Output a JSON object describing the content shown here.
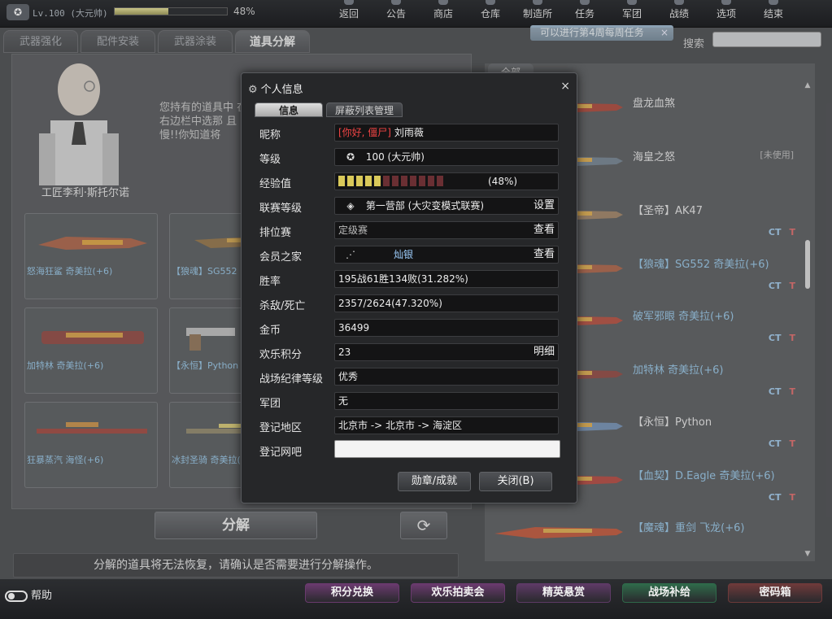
{
  "top": {
    "level_text": "Lv.100 (大元帅)",
    "exp_percent_label": "48%",
    "exp_fraction": 0.48,
    "nav": [
      "返回",
      "公告",
      "商店",
      "仓库",
      "制造所",
      "任务",
      "军团",
      "战绩",
      "选项",
      "结束"
    ]
  },
  "tabs": [
    "武器强化",
    "配件安装",
    "武器涂装",
    "道具分解"
  ],
  "notice": {
    "text": "可以进行第4周每周任务",
    "close": "×"
  },
  "search": {
    "label": "搜索",
    "placeholder": ""
  },
  "npc": {
    "name": "工匠李利·斯托尔诺",
    "speech": "您持有的道具中 在右边栏中选那 且慢!!你知道将"
  },
  "left_weapons": [
    {
      "name": "怒海狂鲨 奇美拉(+6)"
    },
    {
      "name": "【狼魂】SG552"
    },
    {
      "name": "加特林 奇美拉(+6)"
    },
    {
      "name": "【永恒】Python"
    },
    {
      "name": "狂暴蒸汽 海怪(+6)"
    },
    {
      "name": "冰封圣骑 奇美拉(+6)"
    }
  ],
  "actions": {
    "decompose": "分解",
    "refresh_icon": "refresh-icon"
  },
  "warning": "分解的道具将无法恢复，请确认是否需要进行分解操作。",
  "right": {
    "tab_all": "全部",
    "items": [
      {
        "name": "盘龙血煞",
        "tag": "",
        "ct": false,
        "color": "#e8e8e8"
      },
      {
        "name": "海皇之怒",
        "tag": "[未使用]",
        "ct": false,
        "color": "#e8e8e8"
      },
      {
        "name": "【圣帝】AK47",
        "tag": "",
        "ct": true,
        "color": "#e8e8e8"
      },
      {
        "name": "【狼魂】SG552 奇美拉(+6)",
        "tag": "",
        "ct": true,
        "color": "#8fc4e8"
      },
      {
        "name": "破军邪眼 奇美拉(+6)",
        "tag": "",
        "ct": true,
        "color": "#8fc4e8"
      },
      {
        "name": "加特林 奇美拉(+6)",
        "tag": "",
        "ct": true,
        "color": "#8fc4e8"
      },
      {
        "name": "【永恒】Python",
        "tag": "",
        "ct": true,
        "color": "#e8e8e8"
      },
      {
        "name": "【血契】D.Eagle  奇美拉(+6)",
        "tag": "",
        "ct": true,
        "color": "#8fc4e8"
      },
      {
        "name": "【魔魂】重剑 飞龙(+6)",
        "tag": "",
        "ct": false,
        "color": "#8fc4e8"
      }
    ],
    "ct_label": "CT",
    "t_label": "T"
  },
  "bottom": {
    "help": "帮助",
    "buttons": [
      {
        "label": "积分兑换",
        "color": "#6a3a6e"
      },
      {
        "label": "欢乐拍卖会",
        "color": "#6a3a6e"
      },
      {
        "label": "精英悬赏",
        "color": "#5e3a66"
      },
      {
        "label": "战场补给",
        "color": "#2f6a4a"
      },
      {
        "label": "密码箱",
        "color": "#6e3a3a"
      }
    ]
  },
  "dialog": {
    "title": "个人信息",
    "close": "×",
    "tabs": [
      "信息",
      "屏蔽列表管理"
    ],
    "rows": {
      "nickname_label": "昵称",
      "nickname_prefix": "[你好, 僵尸]",
      "nickname": "刘雨薇",
      "level_label": "等级",
      "level_value": "100 (大元帅)",
      "exp_label": "经验值",
      "exp_value": "(48%)",
      "exp_blocks_on": 5,
      "exp_blocks_total": 12,
      "league_label": "联赛等级",
      "league_value": "第一营部 (大灾变模式联赛)",
      "league_btn": "设置",
      "rank_label": "排位赛",
      "rank_value": "定级赛",
      "rank_btn": "查看",
      "member_label": "会员之家",
      "member_value": "灿银",
      "member_btn": "查看",
      "winrate_label": "胜率",
      "winrate_value": "195战61胜134败(31.282%)",
      "kd_label": "杀敌/死亡",
      "kd_value": "2357/2624(47.320%)",
      "gold_label": "金币",
      "gold_value": "36499",
      "fun_label": "欢乐积分",
      "fun_value": "23",
      "fun_btn": "明细",
      "discipline_label": "战场纪律等级",
      "discipline_value": "优秀",
      "clan_label": "军团",
      "clan_value": "无",
      "region_label": "登记地区",
      "region_value": "北京市 -> 北京市 -> 海淀区",
      "netbar_label": "登记网吧",
      "netbar_value": ""
    },
    "medal_btn": "勋章/成就",
    "close_btn": "关闭(B)"
  }
}
